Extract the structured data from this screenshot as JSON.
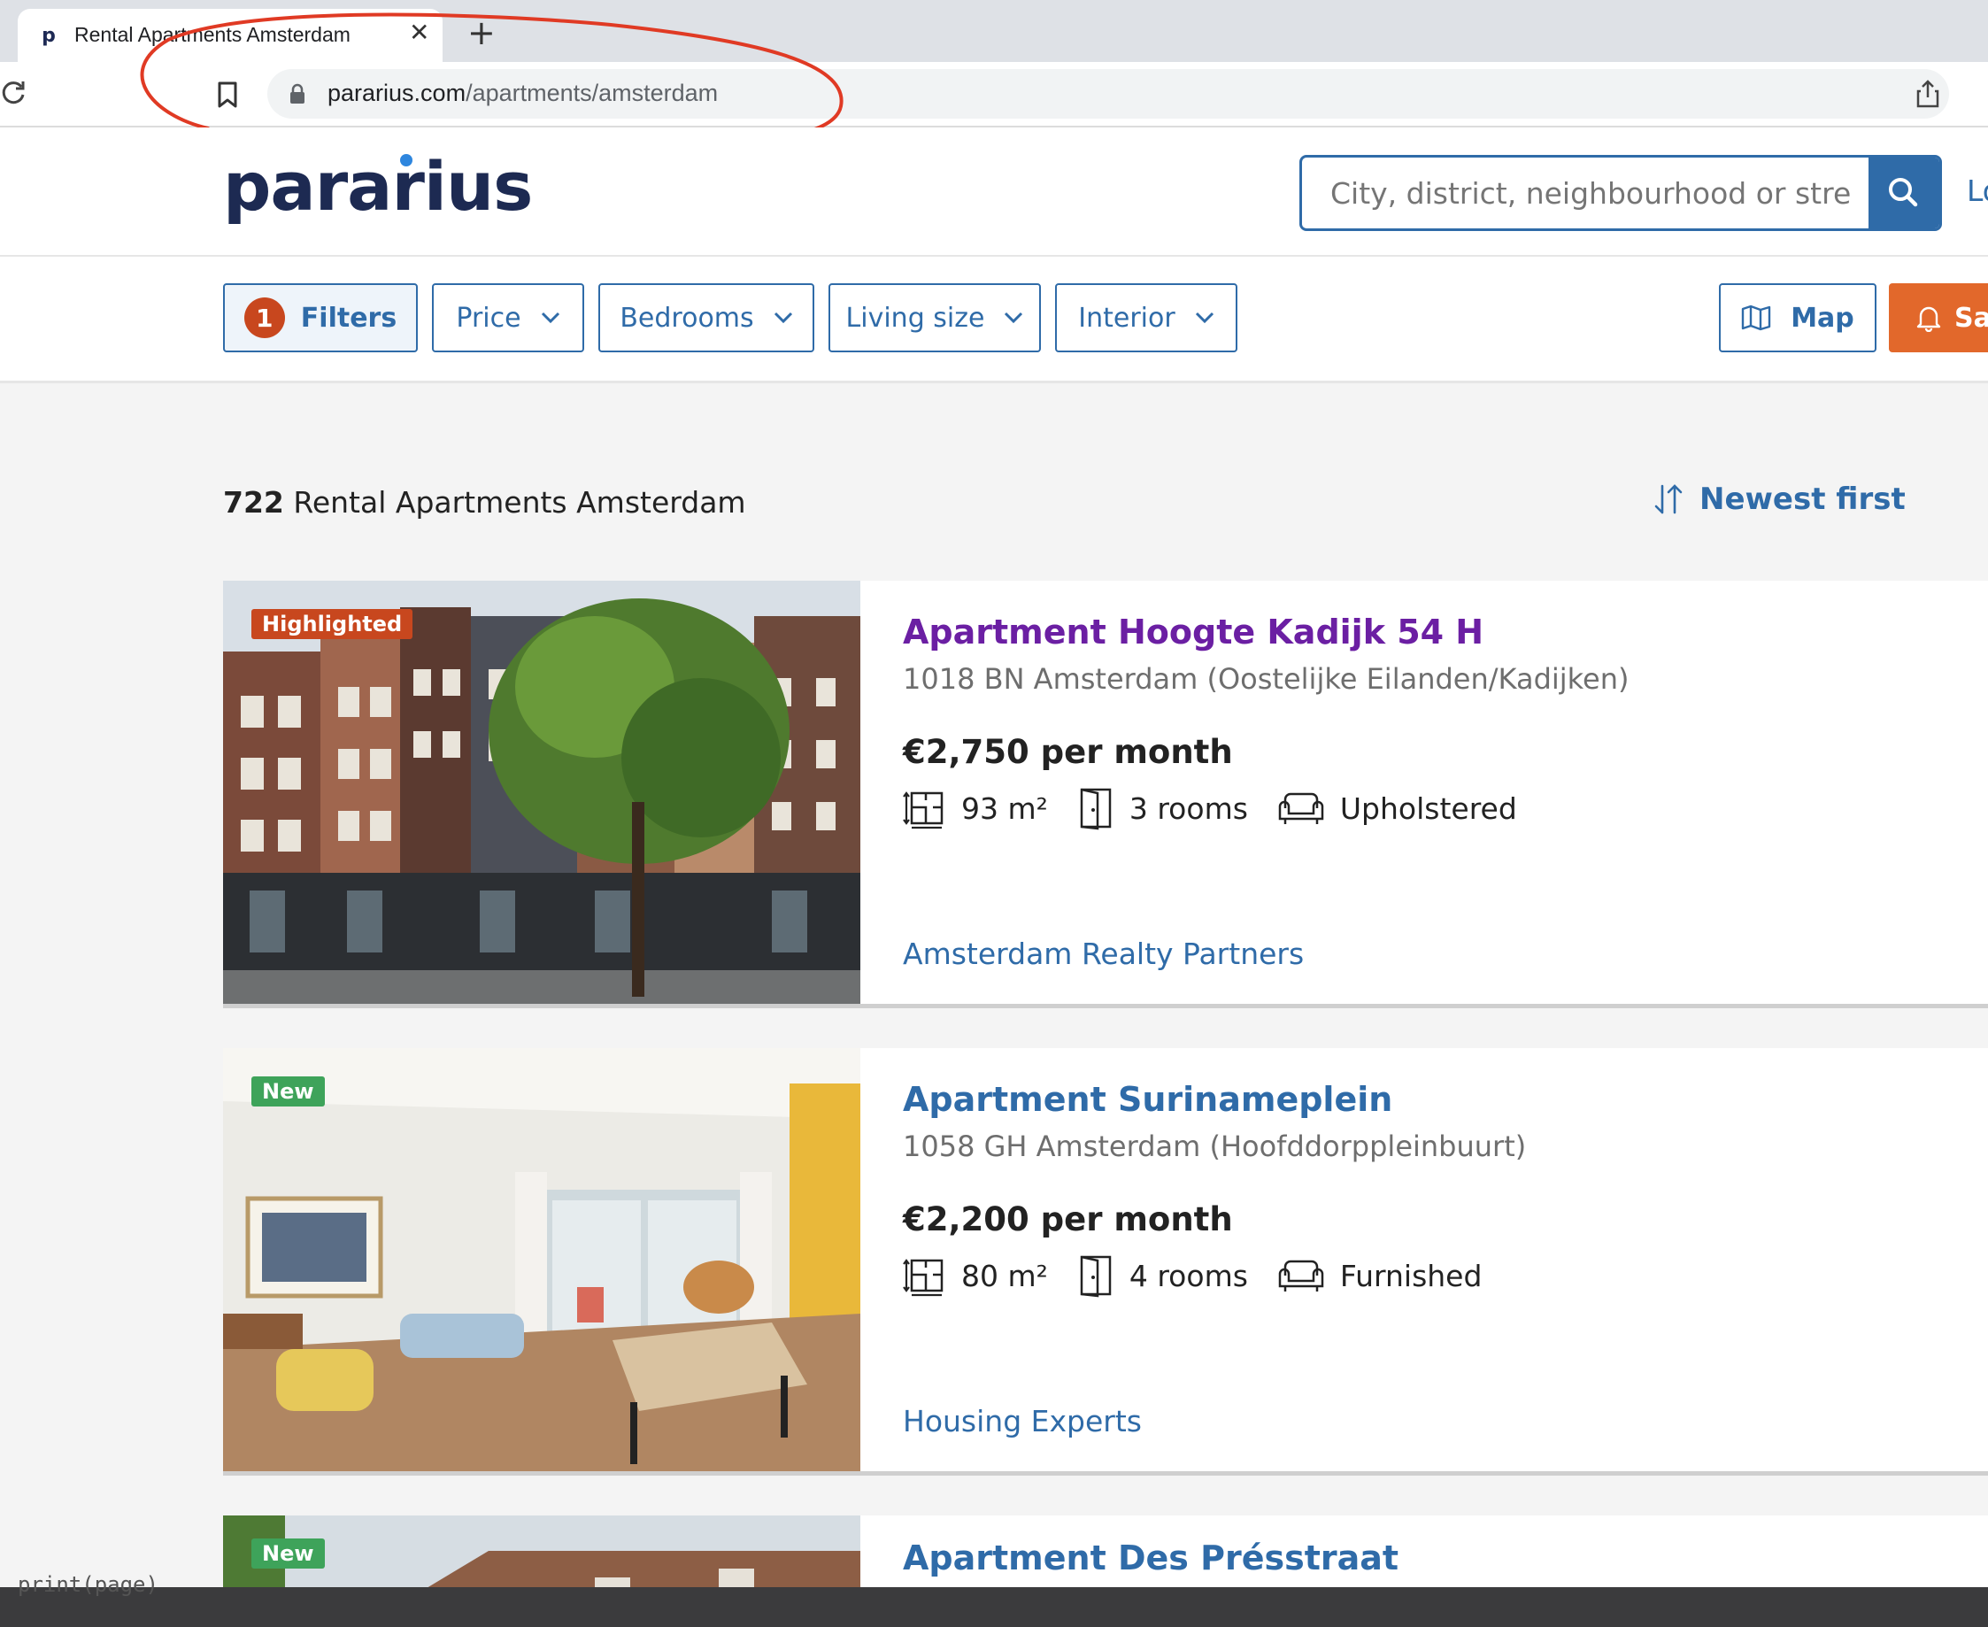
{
  "browser": {
    "tab_title": "Rental Apartments Amsterdam",
    "favicon_letter": "p",
    "close_glyph": "✕",
    "new_tab_glyph": "+",
    "url_host": "pararius.com",
    "url_path": "/apartments/amsterdam"
  },
  "header": {
    "logo_text": "pararius",
    "search_placeholder": "City, district, neighbourhood or stre",
    "login_label": "Lo"
  },
  "filters": {
    "active_count": "1",
    "filters_label": "Filters",
    "dropdowns": [
      "Price",
      "Bedrooms",
      "Living size",
      "Interior"
    ],
    "map_label": "Map",
    "save_label": "Sa"
  },
  "results": {
    "count": "722",
    "heading": "Rental Apartments Amsterdam",
    "sort_label": "Newest first"
  },
  "listings": [
    {
      "badge": "Highlighted",
      "title": "Apartment Hoogte Kadijk 54 H",
      "title_color": "#6b1fa3",
      "address": "1018 BN Amsterdam (Oostelijke Eilanden/Kadijken)",
      "price": "€2,750 per month",
      "size": "93 m²",
      "rooms": "3 rooms",
      "interior": "Upholstered",
      "agent": "Amsterdam Realty Partners"
    },
    {
      "badge": "New",
      "title": "Apartment Surinameplein",
      "title_color": "#2f6ba8",
      "address": "1058 GH Amsterdam (Hoofddorppleinbuurt)",
      "price": "€2,200 per month",
      "size": "80 m²",
      "rooms": "4 rooms",
      "interior": "Furnished",
      "agent": "Housing Experts"
    },
    {
      "badge": "New",
      "title": "Apartment Des Présstraat",
      "title_color": "#2f6ba8"
    }
  ],
  "colors": {
    "brand_blue": "#2f6ba8",
    "logo_navy": "#1d2a52",
    "accent_orange": "#e2682b",
    "badge_highlight": "#c8471e",
    "badge_new": "#3ea35a",
    "annotation_red": "#e03a24"
  },
  "icons": {
    "size": "floorplan-icon",
    "rooms": "door-icon",
    "interior": "sofa-icon",
    "search": "search-icon",
    "sort": "sort-arrows-icon",
    "map": "map-icon",
    "alert": "bell-icon"
  },
  "code_peek": "print(page)"
}
